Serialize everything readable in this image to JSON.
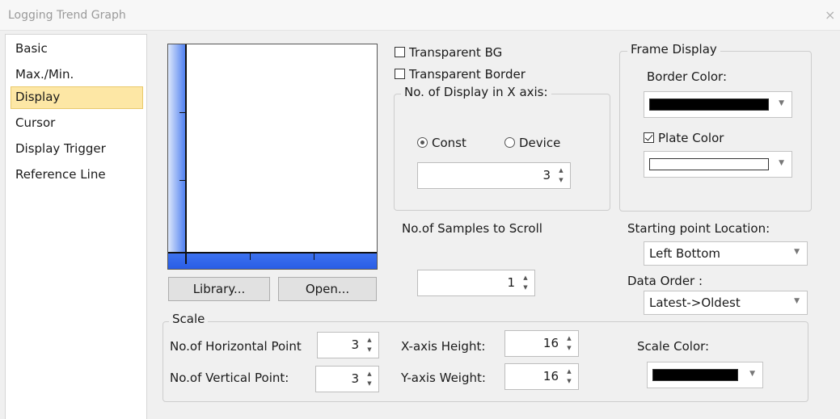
{
  "window": {
    "title": "Logging Trend Graph",
    "close": "×"
  },
  "sidebar": {
    "items": [
      {
        "label": "Basic"
      },
      {
        "label": "Max./Min."
      },
      {
        "label": "Display",
        "selected": true
      },
      {
        "label": "Cursor"
      },
      {
        "label": "Display Trigger"
      },
      {
        "label": "Reference Line"
      }
    ]
  },
  "preview": {
    "library_button": "Library...",
    "open_button": "Open...",
    "colors": {
      "gradient": "#4a7cf0",
      "bar": "#2a5de6"
    }
  },
  "options": {
    "transparent_bg": {
      "label": "Transparent BG",
      "checked": false
    },
    "transparent_border": {
      "label": "Transparent Border",
      "checked": false
    }
  },
  "x_axis_display": {
    "group_label": "No. of Display in X axis:",
    "const_label": "Const",
    "device_label": "Device",
    "selected": "Const",
    "value": "3"
  },
  "frame_display": {
    "group_label": "Frame Display",
    "border_color_label": "Border Color:",
    "border_color": "#000000",
    "plate_color_label": "Plate Color",
    "plate_color_checked": true,
    "plate_color": "#ffffff"
  },
  "scroll": {
    "label": "No.of Samples to Scroll",
    "value": "1"
  },
  "starting_point": {
    "label": "Starting point Location:",
    "value": "Left Bottom"
  },
  "data_order": {
    "label": "Data Order :",
    "value": "Latest->Oldest"
  },
  "scale": {
    "group_label": "Scale",
    "horizontal_point_label": "No.of Horizontal Point",
    "horizontal_point_value": "3",
    "vertical_point_label": "No.of Vertical Point:",
    "vertical_point_value": "3",
    "x_axis_height_label": "X-axis Height:",
    "x_axis_height_value": "16",
    "y_axis_weight_label": "Y-axis Weight:",
    "y_axis_weight_value": "16",
    "scale_color_label": "Scale Color:",
    "scale_color": "#000000"
  },
  "icons": {
    "close": "close-icon",
    "spin_up": "arrow-up-icon",
    "spin_down": "arrow-down-icon",
    "dropdown": "chevron-down-icon"
  }
}
